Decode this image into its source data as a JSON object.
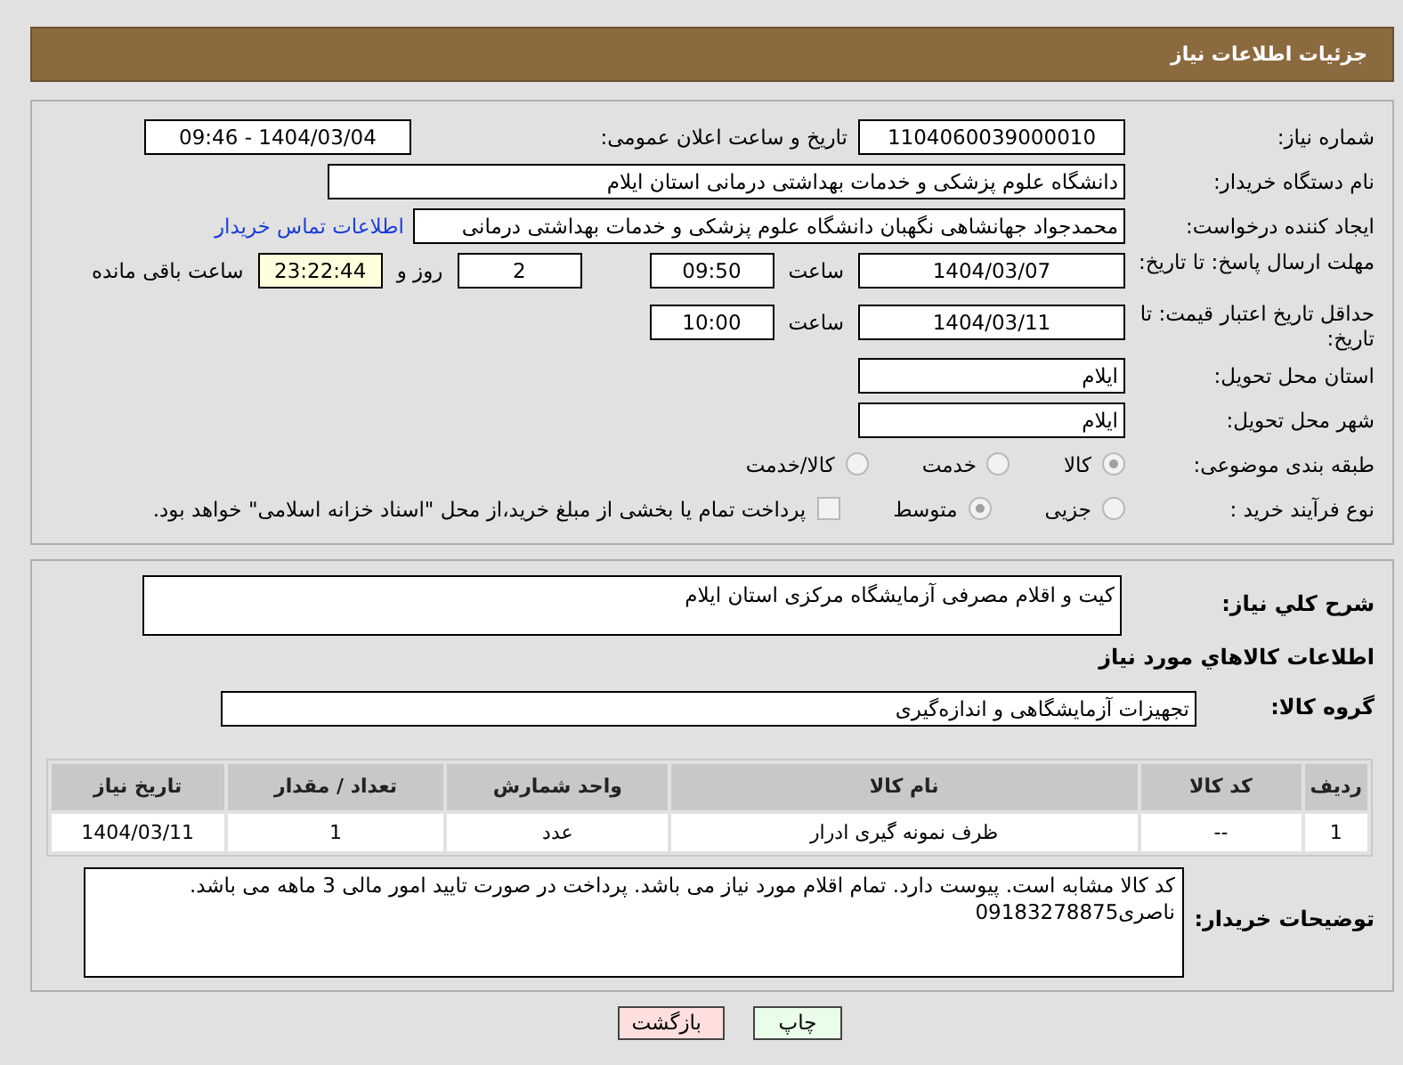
{
  "header": {
    "title": "جزئیات اطلاعات نیاز"
  },
  "details": {
    "need_number": {
      "label": "شماره نیاز:",
      "value": "1104060039000010"
    },
    "announce": {
      "label": "تاریخ و ساعت اعلان عمومی:",
      "value": "1404/03/04 - 09:46"
    },
    "buyer": {
      "label": "نام دستگاه خریدار:",
      "value": "دانشگاه علوم پزشکی و خدمات بهداشتی درمانی استان ایلام"
    },
    "creator": {
      "label": "ایجاد کننده درخواست:",
      "value": "محمدجواد جهانشاهی نگهبان دانشگاه علوم پزشکی و خدمات بهداشتی درمانی",
      "link": "اطلاعات تماس خریدار"
    },
    "deadline": {
      "label": "مهلت ارسال پاسخ: تا تاریخ:",
      "date": "1404/03/07",
      "time_label": "ساعت",
      "time": "09:50",
      "days": "2",
      "days_label": "روز و",
      "remaining": "23:22:44",
      "remaining_label": "ساعت باقی مانده"
    },
    "validity": {
      "label": "حداقل تاریخ اعتبار قیمت: تا تاریخ:",
      "date": "1404/03/11",
      "time_label": "ساعت",
      "time": "10:00"
    },
    "province": {
      "label": "استان محل تحویل:",
      "value": "ایلام"
    },
    "city": {
      "label": "شهر محل تحویل:",
      "value": "ایلام"
    },
    "category": {
      "label": "طبقه بندی موضوعی:",
      "options": [
        {
          "label": "کالا",
          "selected": true
        },
        {
          "label": "خدمت",
          "selected": false
        },
        {
          "label": "کالا/خدمت",
          "selected": false
        }
      ]
    },
    "process": {
      "label": "نوع فرآیند خرید :",
      "options": [
        {
          "label": "جزیی",
          "selected": false
        },
        {
          "label": "متوسط",
          "selected": true
        }
      ],
      "payment": {
        "label": "پرداخت تمام یا بخشی از مبلغ خرید،از محل \"اسناد خزانه اسلامی\" خواهد بود.",
        "checked": false
      }
    }
  },
  "goods": {
    "summary": {
      "label": "شرح کلي نياز:",
      "value": "کیت و اقلام مصرفی آزمایشگاه مرکزی استان ایلام"
    },
    "heading": "اطلاعات کالاهاي مورد نياز",
    "group": {
      "label": "گروه کالا:",
      "value": "تجهیزات آزمایشگاهی و اندازه‌گیری"
    },
    "table": {
      "columns": [
        "ردیف",
        "کد کالا",
        "نام کالا",
        "واحد شمارش",
        "تعداد / مقدار",
        "تاریخ نیاز"
      ],
      "rows": [
        [
          "1",
          "--",
          "ظرف نمونه گیری ادرار",
          "عدد",
          "1",
          "1404/03/11"
        ]
      ]
    },
    "notes": {
      "label": "توضیحات خریدار:",
      "value": "کد کالا مشابه است. پیوست دارد. تمام اقلام مورد نیاز می باشد. پرداخت در صورت تایید امور مالی 3 ماهه می باشد. ناصری09183278875"
    }
  },
  "buttons": [
    {
      "label": "چاپ",
      "kind": "print"
    },
    {
      "label": "بازگشت",
      "kind": "back"
    }
  ]
}
